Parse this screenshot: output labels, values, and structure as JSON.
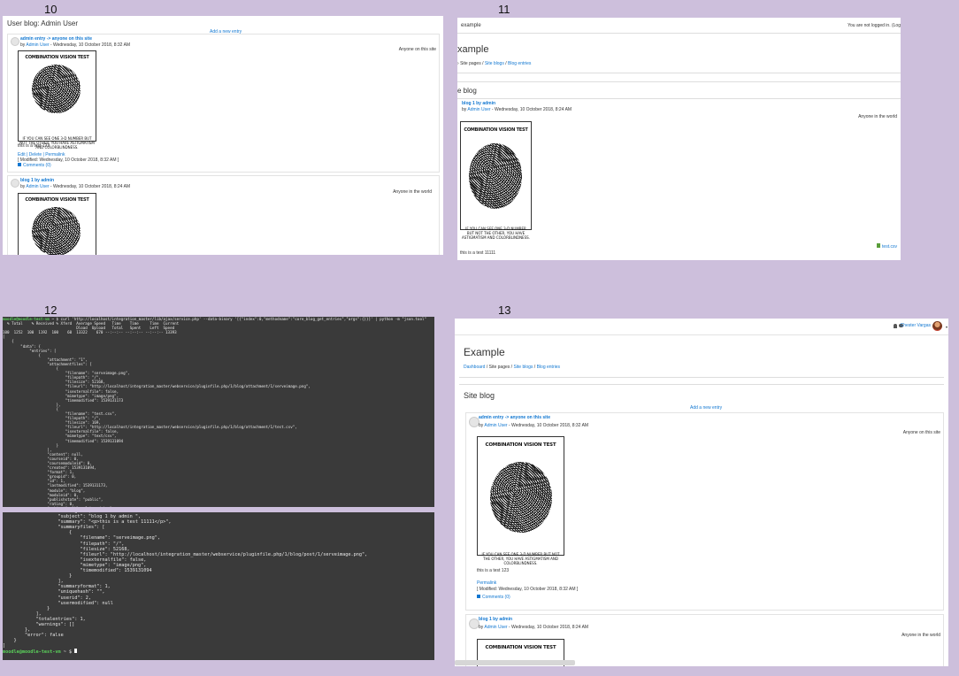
{
  "labels": {
    "p10": "10",
    "p11": "11",
    "p12": "12",
    "p13": "13"
  },
  "panel10": {
    "title": "User blog: Admin User",
    "add_entry": "Add a new entry",
    "entries": [
      {
        "subject": "admin entry -> anyone on this site",
        "by": "by ",
        "author": "Admin User",
        "date": " - Wednesday, 10 October 2018, 8:32 AM",
        "visibility": "Anyone on this site",
        "comic_title": "COMBINATION VISION TEST",
        "caption": "IF YOU CAN SEE ONE 3-D NUMBER BUT NOT THE OTHER, YOU HAVE ASTIGMATISM AND COLORBLINDNESS.",
        "text": "this is a test 123",
        "actions": "Edit | Delete | Permalink",
        "modified": "[ Modified: Wednesday, 10 October 2018, 8:32 AM ]",
        "comments": "Comments (0)"
      },
      {
        "subject": "blog 1 by admin",
        "by": "by ",
        "author": "Admin User",
        "date": " - Wednesday, 10 October 2018, 8:24 AM",
        "visibility": "Anyone in the world",
        "comic_title": "COMBINATION VISION TEST"
      }
    ]
  },
  "panel11": {
    "site": "example",
    "login": "You are not logged in. (Log",
    "heading": "xample",
    "crumbs": [
      "Site pages",
      "Site blogs",
      "Blog entries"
    ],
    "section": "e blog",
    "entry": {
      "subject": "blog 1 by admin",
      "by": "by ",
      "author": "Admin User",
      "date": " - Wednesday, 10 October 2018, 8:24 AM",
      "visibility": "Anyone in the world",
      "comic_title": "COMBINATION VISION TEST",
      "caption": "IF YOU CAN SEE ONE 3-D NUMBER BUT NOT THE OTHER, YOU HAVE ASTIGMATISM AND COLORBLINDNESS.",
      "attachment": "test.csv",
      "text": "this is a test 11111"
    }
  },
  "panel12": {
    "prompt_top": "moodle@moodle-test-vm",
    "command": " ~ $ curl 'http://localhost/integration_master/lib/ajax/service.php' --data-binary '[{\"index\":0,\"methodname\":\"core_blog_get_entries\",\"args\":{}}]' | python -m \"json.tool\"",
    "curl_header": "  % Total    % Received % Xferd  Average Speed   Time    Time     Time  Current\n                                 Dload  Upload   Total   Spent    Left  Speed\n100  1252  100  1192  100    60  13322    670 --:--:-- --:--:-- --:--:-- 13393",
    "json_top": "[\n    {\n        \"data\": {\n            \"entries\": [\n                {\n                    \"attachment\": \"1\",\n                    \"attachmentfiles\": [\n                        {\n                            \"filename\": \"serveimage.png\",\n                            \"filepath\": \"/\",\n                            \"filesize\": 52168,\n                            \"fileurl\": \"http://localhost/integration_master/webservice/pluginfile.php/1/blog/attachment/1/serveimage.png\",\n                            \"isexternalfile\": false,\n                            \"mimetype\": \"image/png\",\n                            \"timemodified\": 1539131173\n                        },\n                        {\n                            \"filename\": \"test.csv\",\n                            \"filepath\": \"/\",\n                            \"filesize\": 169,\n                            \"fileurl\": \"http://localhost/integration_master/webservice/pluginfile.php/1/blog/attachment/1/test.csv\",\n                            \"isexternalfile\": false,\n                            \"mimetype\": \"text/csv\",\n                            \"timemodified\": 1539131094\n                        }\n                    ],\n                    \"content\": null,\n                    \"courseid\": 0,\n                    \"coursemoduleid\": 0,\n                    \"created\": 1539131094,\n                    \"format\": 1,\n                    \"groupid\": 0,\n                    \"id\": 1,\n                    \"lastmodified\": 1539131173,\n                    \"module\": \"blog\",\n                    \"moduleid\": 0,\n                    \"publishstate\": \"public\",\n                    \"rating\": 0,\n                    \"subject\": \"blog 1 by admin \",",
    "json_bottom": "                    \"rating\": 0,\n                    \"subject\": \"blog 1 by admin \",\n                    \"summary\": \"<p>this is a test 11111</p>\",\n                    \"summaryfiles\": [\n                        {\n                            \"filename\": \"serveimage.png\",\n                            \"filepath\": \"/\",\n                            \"filesize\": 52168,\n                            \"fileurl\": \"http://localhost/integration_master/webservice/pluginfile.php/1/blog/post/1/serveimage.png\",\n                            \"isexternalfile\": false,\n                            \"mimetype\": \"image/png\",\n                            \"timemodified\": 1539131094\n                        }\n                    ],\n                    \"summaryformat\": 1,\n                    \"uniquehash\": \"\",\n                    \"userid\": 2,\n                    \"usermodified\": null\n                }\n            ],\n            \"totalentries\": 1,\n            \"warnings\": []\n        },\n        \"error\": false\n    }\n]",
    "prompt_bottom": "moodle@moodle-test-vm",
    "prompt_tail": " ~ $ "
  },
  "panel13": {
    "user": "Chester Vargas",
    "heading": "Example",
    "crumbs": [
      "Dashboard",
      "Site pages",
      "Site blogs",
      "Blog entries"
    ],
    "section": "Site blog",
    "add_entry": "Add a new entry",
    "entries": [
      {
        "subject": "admin entry -> anyone on this site",
        "by": "by ",
        "author": "Admin User",
        "date": " - Wednesday, 10 October 2018, 8:32 AM",
        "visibility": "Anyone on this site",
        "comic_title": "COMBINATION VISION TEST",
        "caption": "IF YOU CAN SEE ONE 3-D NUMBER BUT NOT THE OTHER, YOU HAVE ASTIGMATISM AND COLORBLINDNESS.",
        "text": "this is a test 123",
        "permalink": "Permalink",
        "modified": "[ Modified: Wednesday, 10 October 2018, 8:32 AM ]",
        "comments": "Comments (0)"
      },
      {
        "subject": "blog 1 by admin",
        "by": "by ",
        "author": "Admin User",
        "date": " - Wednesday, 10 October 2018, 8:24 AM",
        "visibility": "Anyone in the world",
        "comic_title": "COMBINATION VISION TEST"
      }
    ]
  },
  "colors": {
    "background": "#cdbfdc",
    "link": "#1177d1",
    "terminal": "#3a3a3a",
    "prompt": "#5ad15a"
  }
}
